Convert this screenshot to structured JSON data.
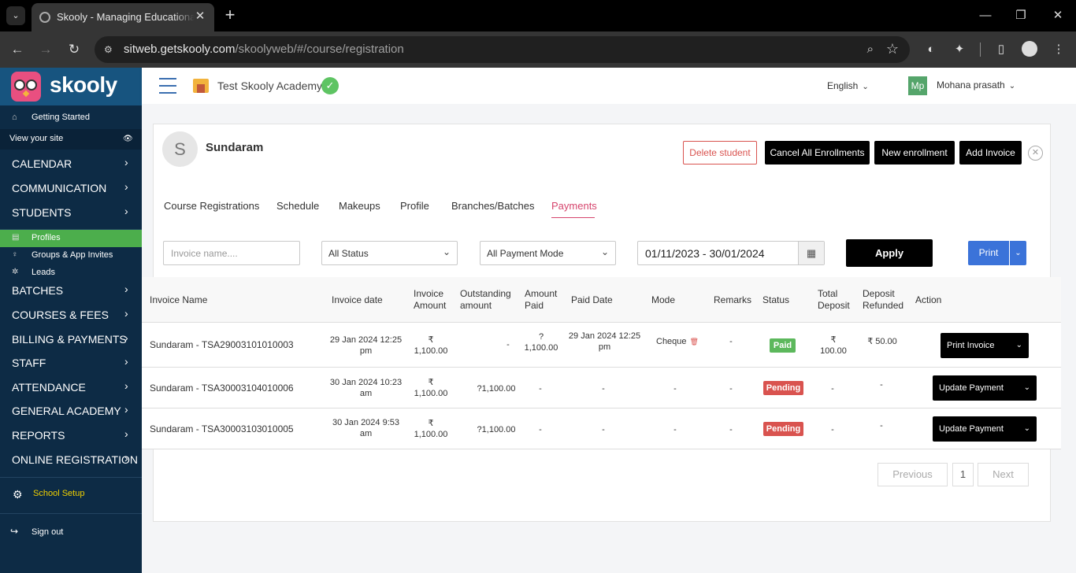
{
  "browser": {
    "tab_title": "Skooly - Managing Educational",
    "url_host": "sitweb.getskooly.com",
    "url_path": "/skoolyweb/#/course/registration"
  },
  "sidebar": {
    "logo_text": "skooly",
    "getting_started": "Getting Started",
    "view_site": "View your site",
    "menu_top": [
      {
        "label": "CALENDAR"
      },
      {
        "label": "COMMUNICATION"
      },
      {
        "label": "STUDENTS"
      }
    ],
    "sub_items": [
      {
        "label": "Profiles",
        "icon": "profile-icon"
      },
      {
        "label": "Groups & App Invites",
        "icon": "group-icon"
      },
      {
        "label": "Leads",
        "icon": "leads-icon"
      }
    ],
    "menu_bottom": [
      {
        "label": "BATCHES"
      },
      {
        "label": "COURSES & FEES"
      },
      {
        "label": "BILLING & PAYMENTS"
      },
      {
        "label": "STAFF"
      },
      {
        "label": "ATTENDANCE"
      },
      {
        "label": "GENERAL ACADEMY"
      },
      {
        "label": "REPORTS"
      },
      {
        "label": "ONLINE REGISTRATION"
      }
    ],
    "school_setup": "School Setup",
    "sign_out": "Sign out"
  },
  "header": {
    "school_name": "Test Skooly Academy",
    "language": "English",
    "avatar_initials": "Mp",
    "user_name": "Mohana prasath"
  },
  "student": {
    "initial": "S",
    "name": "Sundaram"
  },
  "actions": {
    "delete": "Delete student",
    "cancel_all": "Cancel All Enrollments",
    "new_enrollment": "New enrollment",
    "add_invoice": "Add Invoice"
  },
  "tabs": [
    {
      "label": "Course Registrations"
    },
    {
      "label": "Schedule"
    },
    {
      "label": "Makeups"
    },
    {
      "label": "Profile"
    },
    {
      "label": "Branches/Batches"
    },
    {
      "label": "Payments"
    }
  ],
  "filters": {
    "invoice_placeholder": "Invoice name....",
    "status": "All Status",
    "payment_mode": "All Payment Mode",
    "date_range": "01/11/2023 - 30/01/2024",
    "apply": "Apply",
    "print": "Print"
  },
  "table": {
    "headers": {
      "invoice_name": "Invoice Name",
      "invoice_date": "Invoice date",
      "invoice_amount": "Invoice Amount",
      "outstanding": "Outstanding amount",
      "amount_paid": "Amount Paid",
      "paid_date": "Paid Date",
      "mode": "Mode",
      "remarks": "Remarks",
      "status": "Status",
      "total_deposit": "Total Deposit",
      "deposit_refunded": "Deposit Refunded",
      "action": "Action"
    },
    "rows": [
      {
        "invoice_name": "Sundaram - TSA29003101010003",
        "invoice_date": "29 Jan 2024 12:25 pm",
        "invoice_amount": "₹ 1,100.00",
        "outstanding": "-",
        "amount_paid": "? 1,100.00",
        "paid_date": "29 Jan 2024 12:25 pm",
        "mode": "Cheque",
        "remarks": "-",
        "status": "Paid",
        "total_deposit": "₹ 100.00",
        "deposit_refunded": "₹ 50.00",
        "action": "Print Invoice"
      },
      {
        "invoice_name": "Sundaram - TSA30003104010006",
        "invoice_date": "30 Jan 2024 10:23 am",
        "invoice_amount": "₹ 1,100.00",
        "outstanding": "?1,100.00",
        "amount_paid": "-",
        "paid_date": "-",
        "mode": "-",
        "remarks": "-",
        "status": "Pending",
        "total_deposit": "-",
        "deposit_refunded": "-",
        "action": "Update Payment"
      },
      {
        "invoice_name": "Sundaram - TSA30003103010005",
        "invoice_date": "30 Jan 2024 9:53 am",
        "invoice_amount": "₹ 1,100.00",
        "outstanding": "?1,100.00",
        "amount_paid": "-",
        "paid_date": "-",
        "mode": "-",
        "remarks": "-",
        "status": "Pending",
        "total_deposit": "-",
        "deposit_refunded": "-",
        "action": "Update Payment"
      }
    ]
  },
  "pagination": {
    "previous": "Previous",
    "page": "1",
    "next": "Next"
  },
  "colors": {
    "sidebar_bg": "#0d2b45",
    "accent_tab": "#d6456d",
    "paid": "#5cb85c",
    "pending": "#d9534f",
    "print_button": "#3b73d9"
  }
}
